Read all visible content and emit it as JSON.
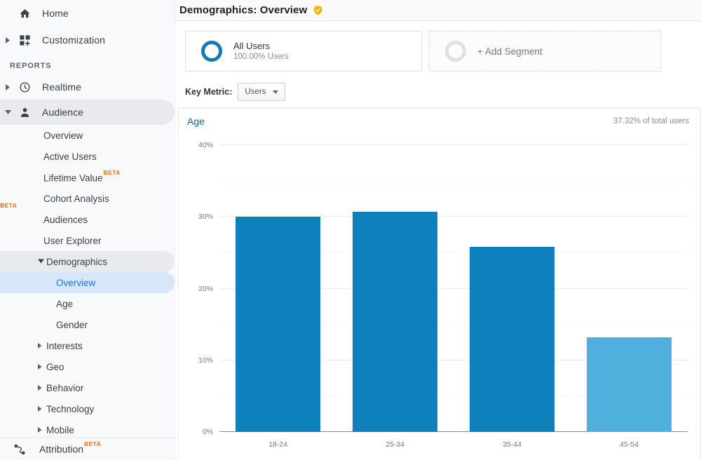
{
  "sidebar": {
    "top_items": [
      {
        "label": "Home",
        "icon": "home-icon",
        "has_caret": false
      },
      {
        "label": "Customization",
        "icon": "customization-icon",
        "has_caret": true
      }
    ],
    "section_label": "REPORTS",
    "report_items": [
      {
        "label": "Realtime",
        "icon": "clock-icon",
        "has_caret": true,
        "selected": false
      },
      {
        "label": "Audience",
        "icon": "person-icon",
        "has_caret": true,
        "selected": true
      }
    ],
    "audience_children": [
      {
        "label": "Overview",
        "badge": ""
      },
      {
        "label": "Active Users",
        "badge": ""
      },
      {
        "label": "Lifetime Value",
        "badge": "BETA",
        "badge_pos": "super"
      },
      {
        "label": "Cohort Analysis",
        "badge": "BETA",
        "badge_pos": "below"
      },
      {
        "label": "Audiences",
        "badge": ""
      },
      {
        "label": "User Explorer",
        "badge": ""
      }
    ],
    "demographics": {
      "label": "Demographics",
      "children": [
        {
          "label": "Overview",
          "active": true
        },
        {
          "label": "Age",
          "active": false
        },
        {
          "label": "Gender",
          "active": false
        }
      ]
    },
    "collapsed_groups": [
      {
        "label": "Interests"
      },
      {
        "label": "Geo"
      },
      {
        "label": "Behavior"
      },
      {
        "label": "Technology"
      },
      {
        "label": "Mobile"
      }
    ],
    "footer": {
      "label": "Attribution",
      "badge": "BETA",
      "icon": "attribution-icon"
    }
  },
  "header": {
    "title": "Demographics: Overview",
    "shield_icon": "verified-shield-icon"
  },
  "segments": {
    "all_users": {
      "title": "All Users",
      "subtitle": "100.00% Users"
    },
    "add_segment": {
      "label": "+ Add Segment"
    }
  },
  "key_metric": {
    "label": "Key Metric:",
    "value": "Users"
  },
  "chart_card": {
    "link_label": "Age",
    "total_label": "37.32% of total users"
  },
  "colors": {
    "bar": "#0e81bc",
    "bar_highlight": "#4fb0dd",
    "link": "#1565a8",
    "accent": "#1a73e8",
    "beta": "#e8710a",
    "shield": "#f4b400"
  },
  "chart_data": {
    "type": "bar",
    "title": "Age",
    "categories": [
      "18-24",
      "25-34",
      "35-44",
      "45-54"
    ],
    "values": [
      30.0,
      30.7,
      25.8,
      13.2
    ],
    "series": [
      {
        "name": "Users",
        "values": [
          30.0,
          30.7,
          25.8,
          13.2
        ]
      }
    ],
    "highlighted_index": 3,
    "xlabel": "",
    "ylabel": "",
    "ylim": [
      0,
      40
    ],
    "yticks": [
      0,
      10,
      20,
      30,
      40
    ],
    "ytick_labels": [
      "0%",
      "10%",
      "20%",
      "30%",
      "40%"
    ],
    "minor_yticks": [
      5,
      15,
      25,
      35
    ],
    "grid": true,
    "legend": "none",
    "annotation": "37.32% of total users"
  }
}
